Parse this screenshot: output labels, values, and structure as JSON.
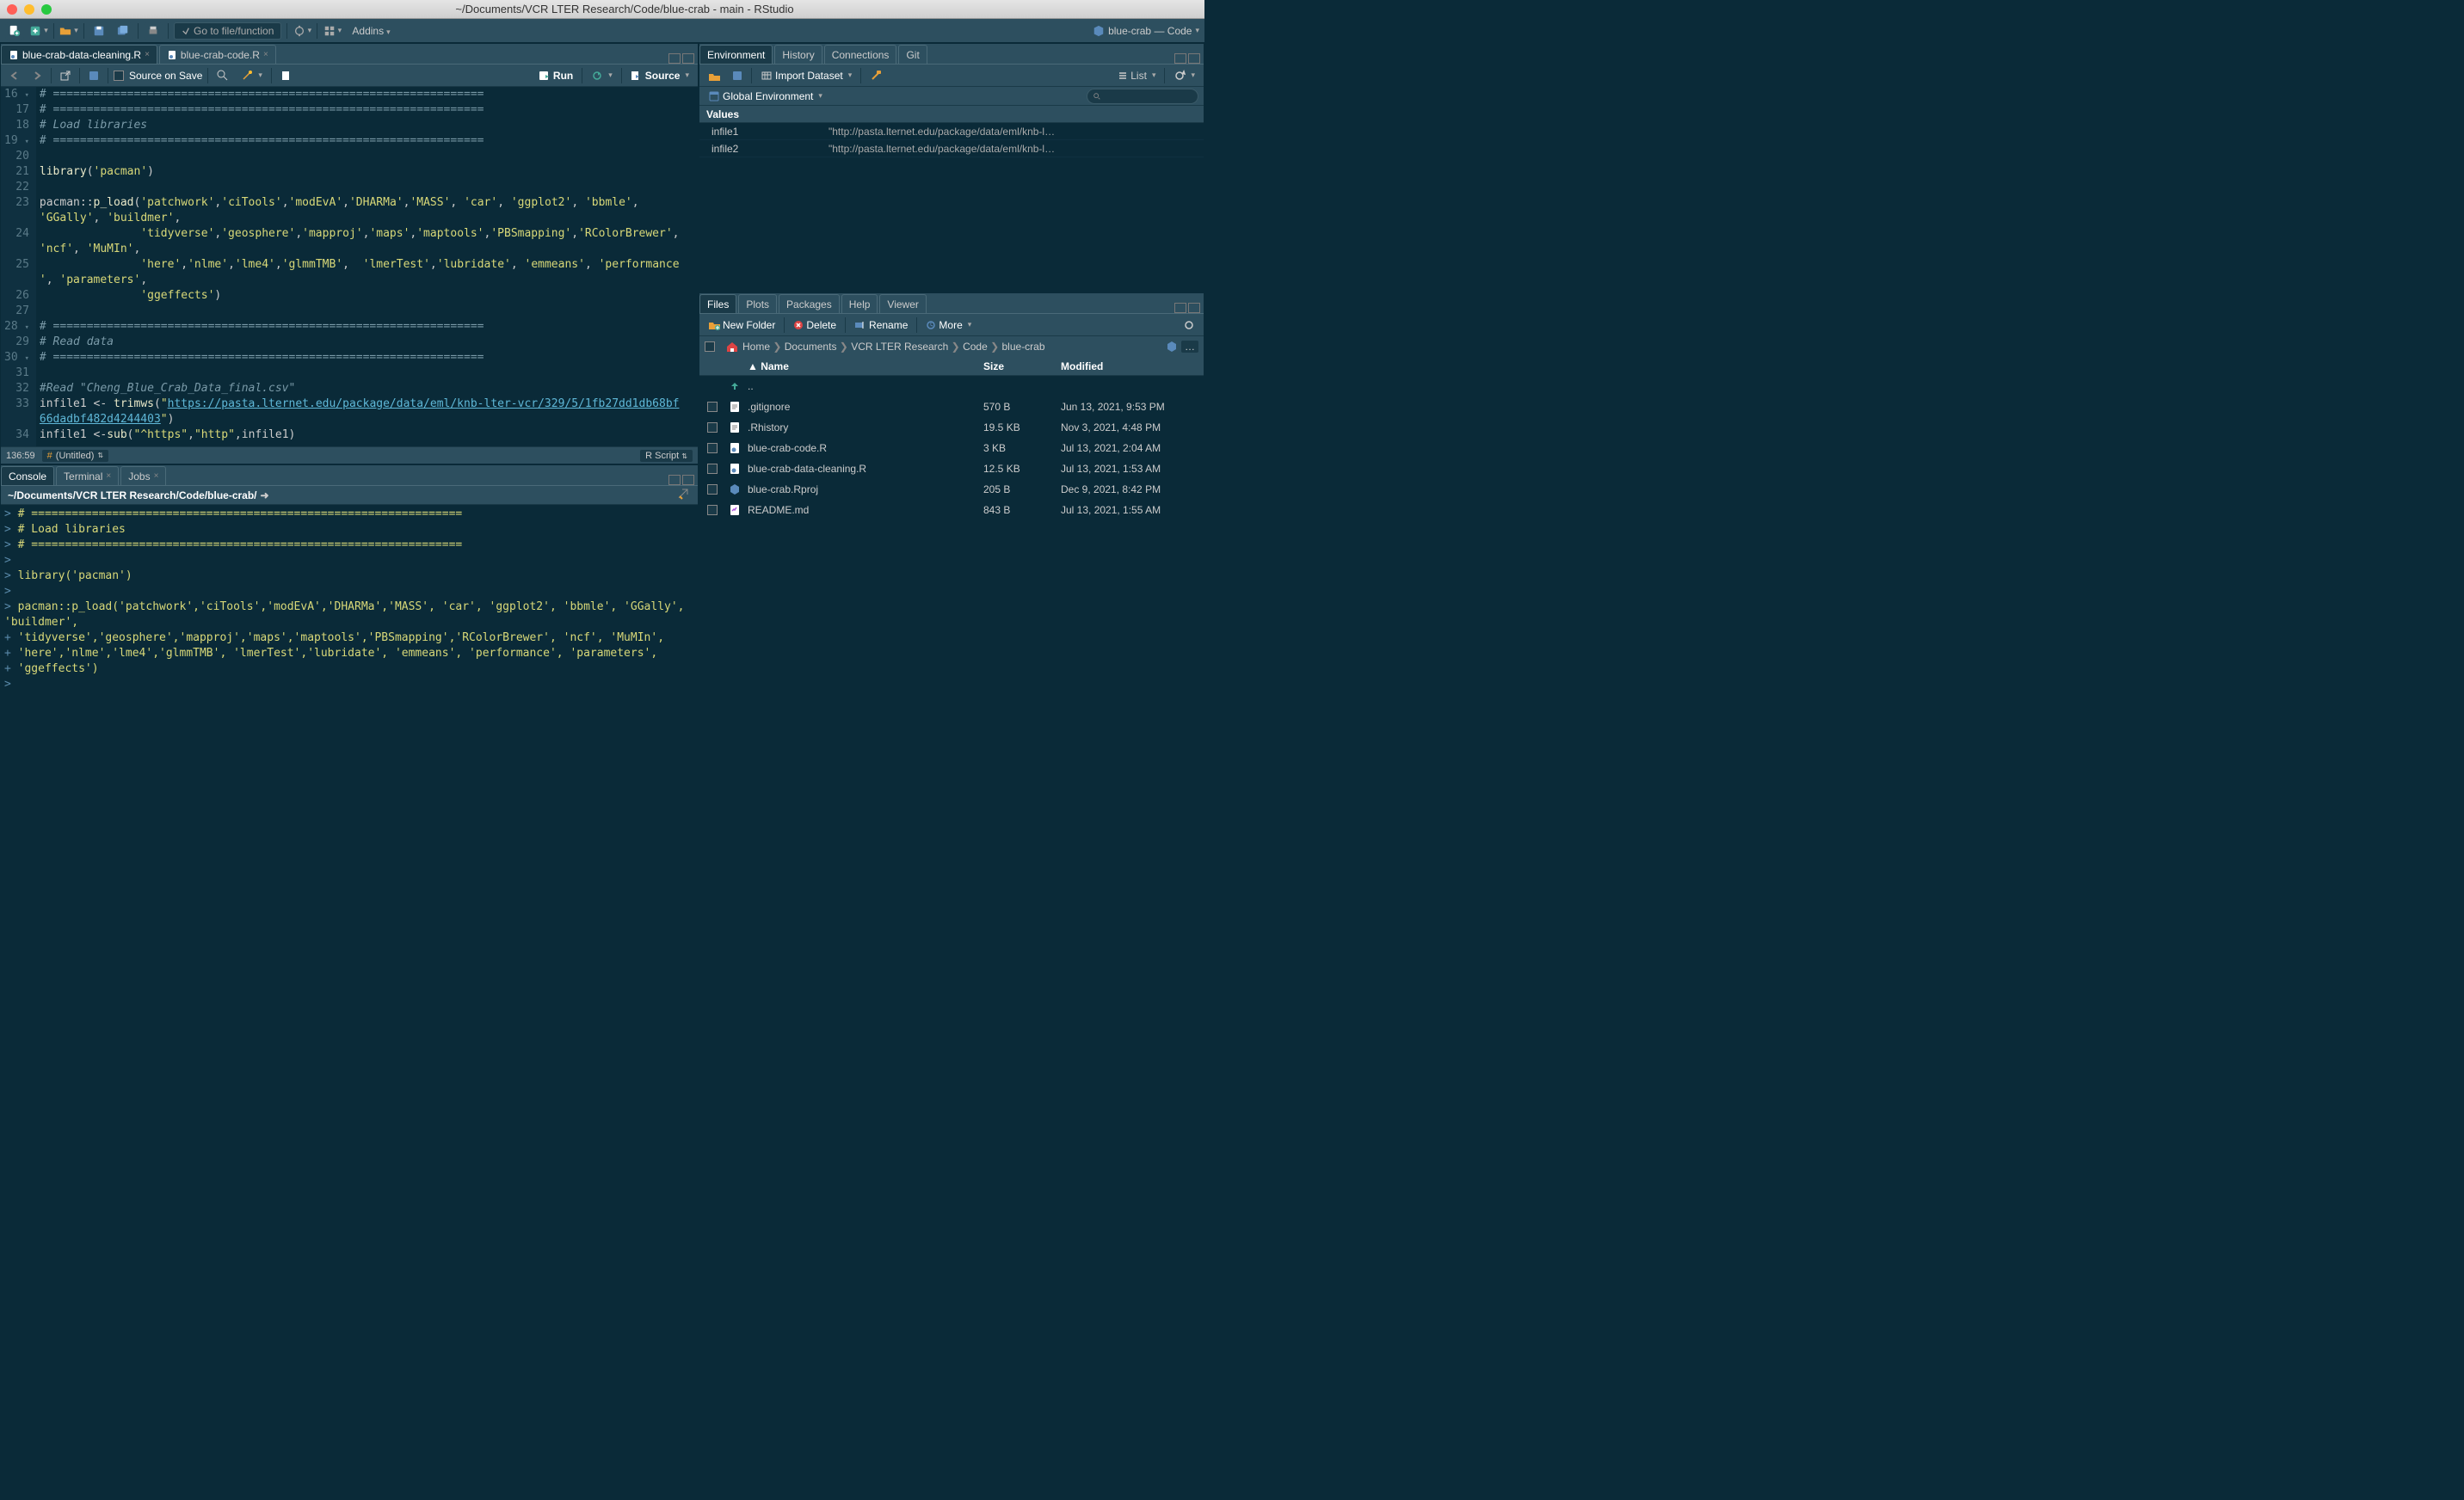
{
  "window": {
    "title": "~/Documents/VCR LTER Research/Code/blue-crab - main - RStudio"
  },
  "maintoolbar": {
    "goto_placeholder": "Go to file/function",
    "addins_label": "Addins",
    "project_label": "blue-crab — Code"
  },
  "editor_tabs": [
    {
      "label": "blue-crab-data-cleaning.R",
      "active": true
    },
    {
      "label": "blue-crab-code.R",
      "active": false
    }
  ],
  "editor_toolbar": {
    "source_on_save": "Source on Save",
    "run_label": "Run",
    "source_label": "Source"
  },
  "code_lines": [
    {
      "num": "16",
      "fold": true,
      "tokens": [
        {
          "cls": "c-comment",
          "t": "# ================================================================"
        }
      ]
    },
    {
      "num": "17",
      "tokens": [
        {
          "cls": "c-comment",
          "t": "# ================================================================"
        }
      ]
    },
    {
      "num": "18",
      "tokens": [
        {
          "cls": "c-comment",
          "t": "# Load libraries"
        }
      ]
    },
    {
      "num": "19",
      "fold": true,
      "tokens": [
        {
          "cls": "c-comment",
          "t": "# ================================================================"
        }
      ]
    },
    {
      "num": "20",
      "tokens": []
    },
    {
      "num": "21",
      "tokens": [
        {
          "cls": "c-func",
          "t": "library"
        },
        {
          "cls": "c-op",
          "t": "("
        },
        {
          "cls": "c-str",
          "t": "'pacman'"
        },
        {
          "cls": "c-op",
          "t": ")"
        }
      ]
    },
    {
      "num": "22",
      "tokens": []
    },
    {
      "num": "23",
      "tokens": [
        {
          "cls": "c-kw",
          "t": "pacman"
        },
        {
          "cls": "c-op",
          "t": "::"
        },
        {
          "cls": "c-func",
          "t": "p_load"
        },
        {
          "cls": "c-op",
          "t": "("
        },
        {
          "cls": "c-str",
          "t": "'patchwork'"
        },
        {
          "cls": "c-op",
          "t": ","
        },
        {
          "cls": "c-str",
          "t": "'ciTools'"
        },
        {
          "cls": "c-op",
          "t": ","
        },
        {
          "cls": "c-str",
          "t": "'modEvA'"
        },
        {
          "cls": "c-op",
          "t": ","
        },
        {
          "cls": "c-str",
          "t": "'DHARMa'"
        },
        {
          "cls": "c-op",
          "t": ","
        },
        {
          "cls": "c-str",
          "t": "'MASS'"
        },
        {
          "cls": "c-op",
          "t": ", "
        },
        {
          "cls": "c-str",
          "t": "'car'"
        },
        {
          "cls": "c-op",
          "t": ", "
        },
        {
          "cls": "c-str",
          "t": "'ggplot2'"
        },
        {
          "cls": "c-op",
          "t": ", "
        },
        {
          "cls": "c-str",
          "t": "'bbmle'"
        },
        {
          "cls": "c-op",
          "t": ", "
        }
      ]
    },
    {
      "num": "",
      "tokens": [
        {
          "cls": "c-str",
          "t": "'GGally'"
        },
        {
          "cls": "c-op",
          "t": ", "
        },
        {
          "cls": "c-str",
          "t": "'buildmer'"
        },
        {
          "cls": "c-op",
          "t": ","
        }
      ]
    },
    {
      "num": "24",
      "tokens": [
        {
          "cls": "c-op",
          "t": "               "
        },
        {
          "cls": "c-str",
          "t": "'tidyverse'"
        },
        {
          "cls": "c-op",
          "t": ","
        },
        {
          "cls": "c-str",
          "t": "'geosphere'"
        },
        {
          "cls": "c-op",
          "t": ","
        },
        {
          "cls": "c-str",
          "t": "'mapproj'"
        },
        {
          "cls": "c-op",
          "t": ","
        },
        {
          "cls": "c-str",
          "t": "'maps'"
        },
        {
          "cls": "c-op",
          "t": ","
        },
        {
          "cls": "c-str",
          "t": "'maptools'"
        },
        {
          "cls": "c-op",
          "t": ","
        },
        {
          "cls": "c-str",
          "t": "'PBSmapping'"
        },
        {
          "cls": "c-op",
          "t": ","
        },
        {
          "cls": "c-str",
          "t": "'RColorBrewer'"
        },
        {
          "cls": "c-op",
          "t": ","
        }
      ]
    },
    {
      "num": "",
      "tokens": [
        {
          "cls": "c-str",
          "t": "'ncf'"
        },
        {
          "cls": "c-op",
          "t": ", "
        },
        {
          "cls": "c-str",
          "t": "'MuMIn'"
        },
        {
          "cls": "c-op",
          "t": ","
        }
      ]
    },
    {
      "num": "25",
      "tokens": [
        {
          "cls": "c-op",
          "t": "               "
        },
        {
          "cls": "c-str",
          "t": "'here'"
        },
        {
          "cls": "c-op",
          "t": ","
        },
        {
          "cls": "c-str",
          "t": "'nlme'"
        },
        {
          "cls": "c-op",
          "t": ","
        },
        {
          "cls": "c-str",
          "t": "'lme4'"
        },
        {
          "cls": "c-op",
          "t": ","
        },
        {
          "cls": "c-str",
          "t": "'glmmTMB'"
        },
        {
          "cls": "c-op",
          "t": ",  "
        },
        {
          "cls": "c-str",
          "t": "'lmerTest'"
        },
        {
          "cls": "c-op",
          "t": ","
        },
        {
          "cls": "c-str",
          "t": "'lubridate'"
        },
        {
          "cls": "c-op",
          "t": ", "
        },
        {
          "cls": "c-str",
          "t": "'emmeans'"
        },
        {
          "cls": "c-op",
          "t": ", "
        },
        {
          "cls": "c-str",
          "t": "'performance"
        }
      ]
    },
    {
      "num": "",
      "tokens": [
        {
          "cls": "c-str",
          "t": "'"
        },
        {
          "cls": "c-op",
          "t": ", "
        },
        {
          "cls": "c-str",
          "t": "'parameters'"
        },
        {
          "cls": "c-op",
          "t": ","
        }
      ]
    },
    {
      "num": "26",
      "tokens": [
        {
          "cls": "c-op",
          "t": "               "
        },
        {
          "cls": "c-str",
          "t": "'ggeffects'"
        },
        {
          "cls": "c-op",
          "t": ")"
        }
      ]
    },
    {
      "num": "27",
      "tokens": []
    },
    {
      "num": "28",
      "fold": true,
      "tokens": [
        {
          "cls": "c-comment",
          "t": "# ================================================================"
        }
      ]
    },
    {
      "num": "29",
      "tokens": [
        {
          "cls": "c-comment",
          "t": "# Read data"
        }
      ]
    },
    {
      "num": "30",
      "fold": true,
      "tokens": [
        {
          "cls": "c-comment",
          "t": "# ================================================================"
        }
      ]
    },
    {
      "num": "31",
      "tokens": []
    },
    {
      "num": "32",
      "tokens": [
        {
          "cls": "c-comment",
          "t": "#Read \"Cheng_Blue_Crab_Data_final.csv\""
        }
      ]
    },
    {
      "num": "33",
      "tokens": [
        {
          "cls": "c-kw",
          "t": "infile1 "
        },
        {
          "cls": "c-op",
          "t": "<- "
        },
        {
          "cls": "c-func",
          "t": "trimws"
        },
        {
          "cls": "c-op",
          "t": "("
        },
        {
          "cls": "c-str",
          "t": "\""
        },
        {
          "cls": "c-url",
          "t": "https://pasta.lternet.edu/package/data/eml/knb-lter-vcr/329/5/1fb27dd1db68bf"
        }
      ]
    },
    {
      "num": "",
      "tokens": [
        {
          "cls": "c-url",
          "t": "66dadbf482d4244403"
        },
        {
          "cls": "c-str",
          "t": "\""
        },
        {
          "cls": "c-op",
          "t": ")"
        }
      ]
    },
    {
      "num": "34",
      "tokens": [
        {
          "cls": "c-kw",
          "t": "infile1 "
        },
        {
          "cls": "c-op",
          "t": "<-"
        },
        {
          "cls": "c-func",
          "t": "sub"
        },
        {
          "cls": "c-op",
          "t": "("
        },
        {
          "cls": "c-str",
          "t": "\"^https\""
        },
        {
          "cls": "c-op",
          "t": ","
        },
        {
          "cls": "c-str",
          "t": "\"http\""
        },
        {
          "cls": "c-op",
          "t": ",infile1)"
        }
      ]
    }
  ],
  "statusbar": {
    "cursor": "136:59",
    "section": "(Untitled)",
    "lang": "R Script"
  },
  "bottom_tabs": [
    {
      "label": "Console",
      "active": true
    },
    {
      "label": "Terminal",
      "active": false
    },
    {
      "label": "Jobs",
      "active": false
    }
  ],
  "console_path": "~/Documents/VCR LTER Research/Code/blue-crab/",
  "console_lines": [
    "> # ================================================================",
    "> # Load libraries",
    "> # ================================================================",
    "> ",
    "> library('pacman')",
    "> ",
    "> pacman::p_load('patchwork','ciTools','modEvA','DHARMa','MASS', 'car', 'ggplot2', 'bbmle', 'GGally', 'buildmer',",
    "+                'tidyverse','geosphere','mapproj','maps','maptools','PBSmapping','RColorBrewer', 'ncf', 'MuMIn',",
    "+                'here','nlme','lme4','glmmTMB',  'lmerTest','lubridate', 'emmeans', 'performance', 'parameters',",
    "+                'ggeffects')",
    "> "
  ],
  "env_tabs": [
    "Environment",
    "History",
    "Connections",
    "Git"
  ],
  "env_toolbar": {
    "import_label": "Import Dataset",
    "list_label": "List",
    "scope_label": "Global Environment"
  },
  "env_header": "Values",
  "env_values": [
    {
      "name": "infile1",
      "value": "\"http://pasta.lternet.edu/package/data/eml/knb-l…"
    },
    {
      "name": "infile2",
      "value": "\"http://pasta.lternet.edu/package/data/eml/knb-l…"
    }
  ],
  "files_tabs": [
    "Files",
    "Plots",
    "Packages",
    "Help",
    "Viewer"
  ],
  "files_toolbar": {
    "new_folder": "New Folder",
    "delete": "Delete",
    "rename": "Rename",
    "more": "More"
  },
  "breadcrumb": [
    "Home",
    "Documents",
    "VCR LTER Research",
    "Code",
    "blue-crab"
  ],
  "files_header": {
    "name": "Name",
    "size": "Size",
    "modified": "Modified"
  },
  "files_updir": "..",
  "files": [
    {
      "icon": "txt",
      "name": ".gitignore",
      "size": "570 B",
      "modified": "Jun 13, 2021, 9:53 PM"
    },
    {
      "icon": "txt",
      "name": ".Rhistory",
      "size": "19.5 KB",
      "modified": "Nov 3, 2021, 4:48 PM"
    },
    {
      "icon": "r",
      "name": "blue-crab-code.R",
      "size": "3 KB",
      "modified": "Jul 13, 2021, 2:04 AM"
    },
    {
      "icon": "r",
      "name": "blue-crab-data-cleaning.R",
      "size": "12.5 KB",
      "modified": "Jul 13, 2021, 1:53 AM"
    },
    {
      "icon": "rproj",
      "name": "blue-crab.Rproj",
      "size": "205 B",
      "modified": "Dec 9, 2021, 8:42 PM"
    },
    {
      "icon": "md",
      "name": "README.md",
      "size": "843 B",
      "modified": "Jul 13, 2021, 1:55 AM"
    }
  ]
}
